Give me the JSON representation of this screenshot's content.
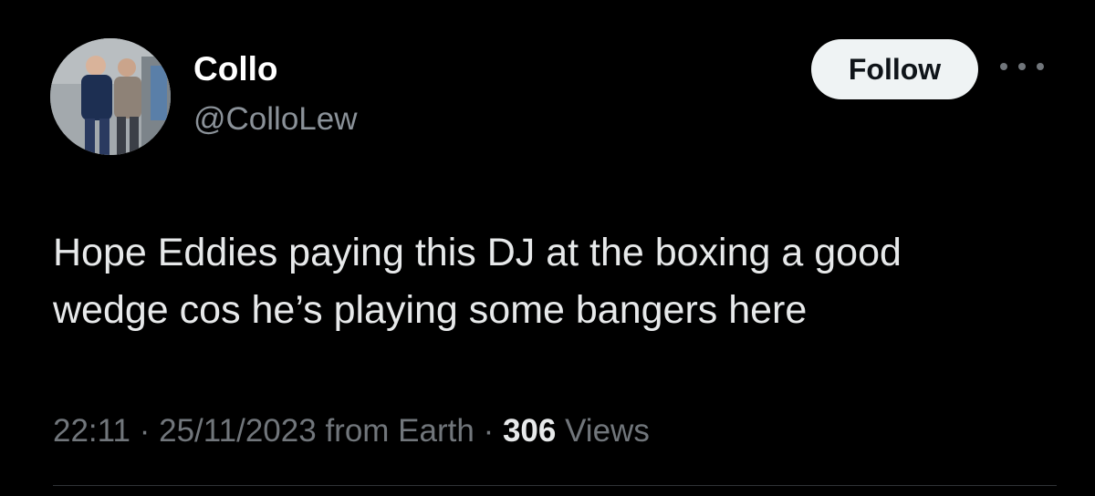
{
  "user": {
    "display_name": "Collo",
    "handle": "@ColloLew"
  },
  "actions": {
    "follow_label": "Follow",
    "more_icon": "more-horizontal-icon"
  },
  "tweet": {
    "line1": "Hope Eddies paying this DJ at the boxing a good",
    "line2": "wedge cos he’s playing some bangers here"
  },
  "meta": {
    "time": "22:11",
    "separator": "·",
    "date": "25/11/2023",
    "source": "from Earth",
    "views_count": "306",
    "views_label": "Views"
  },
  "colors": {
    "background": "#000000",
    "text_primary": "#e7e9ea",
    "text_secondary": "#71767b",
    "follow_bg": "#eff3f4"
  }
}
